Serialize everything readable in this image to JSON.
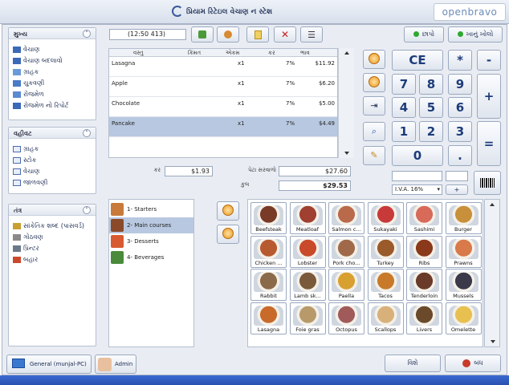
{
  "window": {
    "title": "પ્રિયામ રિટેઇલ વેચાણ ન સ્ટેશ",
    "brand": "openbravo"
  },
  "sidebar": {
    "groups": [
      {
        "title": "મુખ્ય",
        "items": [
          "વેચાણ",
          "વેચાણ બદલાવો",
          "ગ્રાહક",
          "ચુકવણી",
          "રોજમેળ",
          "રોજમેળ નો રિપોર્ટ"
        ]
      },
      {
        "title": "વહીવટ",
        "items": [
          "ગ્રાહક",
          "સ્ટોક",
          "વેચાણ",
          "જાળવણી"
        ]
      },
      {
        "title": "તંત્ર",
        "items": [
          "સાંકેતિક શબ્દ (પાસવર્ડ)",
          "ગોઠવણ",
          "પ્રિન્ટર",
          "બહાર"
        ]
      }
    ]
  },
  "toolbar": {
    "ticket_id": "(12:50 413)",
    "print_label": "છાપો",
    "drawer_label": "ખાનું ખોલો"
  },
  "order": {
    "columns": [
      "વસ્તુ",
      "કિંમત",
      "એકમ",
      "કર",
      "ભાવ"
    ],
    "rows": [
      {
        "item": "Lasagna",
        "qty": "x1",
        "tax": "7%",
        "price": "$11.92"
      },
      {
        "item": "Apple",
        "qty": "x1",
        "tax": "7%",
        "price": "$6.20"
      },
      {
        "item": "Chocolate",
        "qty": "x1",
        "tax": "7%",
        "price": "$5.00"
      },
      {
        "item": "Pancake",
        "qty": "x1",
        "tax": "7%",
        "price": "$4.49"
      }
    ],
    "selected_index": 3
  },
  "totals": {
    "tax_label": "કર",
    "tax_value": "$1.93",
    "subtotal_label": "પેટા સરવાળો",
    "subtotal_value": "$27.60",
    "total_label": "કુલ",
    "total_value": "$29.53"
  },
  "keypad": {
    "ce": "CE",
    "mul": "*",
    "minus": "-",
    "plus": "+",
    "equals": "=",
    "dot": ".",
    "digits": [
      "7",
      "8",
      "9",
      "4",
      "5",
      "6",
      "1",
      "2",
      "3",
      "0"
    ],
    "tax_select": "I.V.A. 16%",
    "small_plus": "+"
  },
  "categories": [
    {
      "label": "1- Starters",
      "color": "#c87a3a"
    },
    {
      "label": "2- Main courses",
      "color": "#8a4a2a"
    },
    {
      "label": "3- Desserts",
      "color": "#d85a30"
    },
    {
      "label": "4- Beverages",
      "color": "#4a8a3a"
    }
  ],
  "category_selected_index": 1,
  "products": [
    {
      "label": "Beefsteak",
      "color": "#7a3a28"
    },
    {
      "label": "Meatloaf",
      "color": "#a04030"
    },
    {
      "label": "Salmon c...",
      "color": "#b86a4a"
    },
    {
      "label": "Sukayaki",
      "color": "#c83a3a"
    },
    {
      "label": "Sashimi",
      "color": "#d86a5a"
    },
    {
      "label": "Burger",
      "color": "#c8903a"
    },
    {
      "label": "Chicken ...",
      "color": "#b85a30"
    },
    {
      "label": "Lobster",
      "color": "#c84a2a"
    },
    {
      "label": "Pork cho...",
      "color": "#a06a4a"
    },
    {
      "label": "Turkey",
      "color": "#9a5a2a"
    },
    {
      "label": "Ribs",
      "color": "#8a3a1a"
    },
    {
      "label": "Prawns",
      "color": "#d87a4a"
    },
    {
      "label": "Rabbit",
      "color": "#8a6a4a"
    },
    {
      "label": "Lamb sk...",
      "color": "#7a5a3a"
    },
    {
      "label": "Paella",
      "color": "#d8a030"
    },
    {
      "label": "Tacos",
      "color": "#c87a2a"
    },
    {
      "label": "Tenderloin",
      "color": "#6a3a2a"
    },
    {
      "label": "Mussels",
      "color": "#3a3a4a"
    },
    {
      "label": "Lasagna",
      "color": "#c86a2a"
    },
    {
      "label": "Foie gras",
      "color": "#b89a6a"
    },
    {
      "label": "Octopus",
      "color": "#a05a5a"
    },
    {
      "label": "Scallops",
      "color": "#d8b07a"
    },
    {
      "label": "Livers",
      "color": "#6a4a2a"
    },
    {
      "label": "Omelette",
      "color": "#e8c050"
    }
  ],
  "footer": {
    "host": "General (munjal-PC)",
    "user": "Admin",
    "help_label": "વિશે",
    "close_label": "બંધ"
  }
}
